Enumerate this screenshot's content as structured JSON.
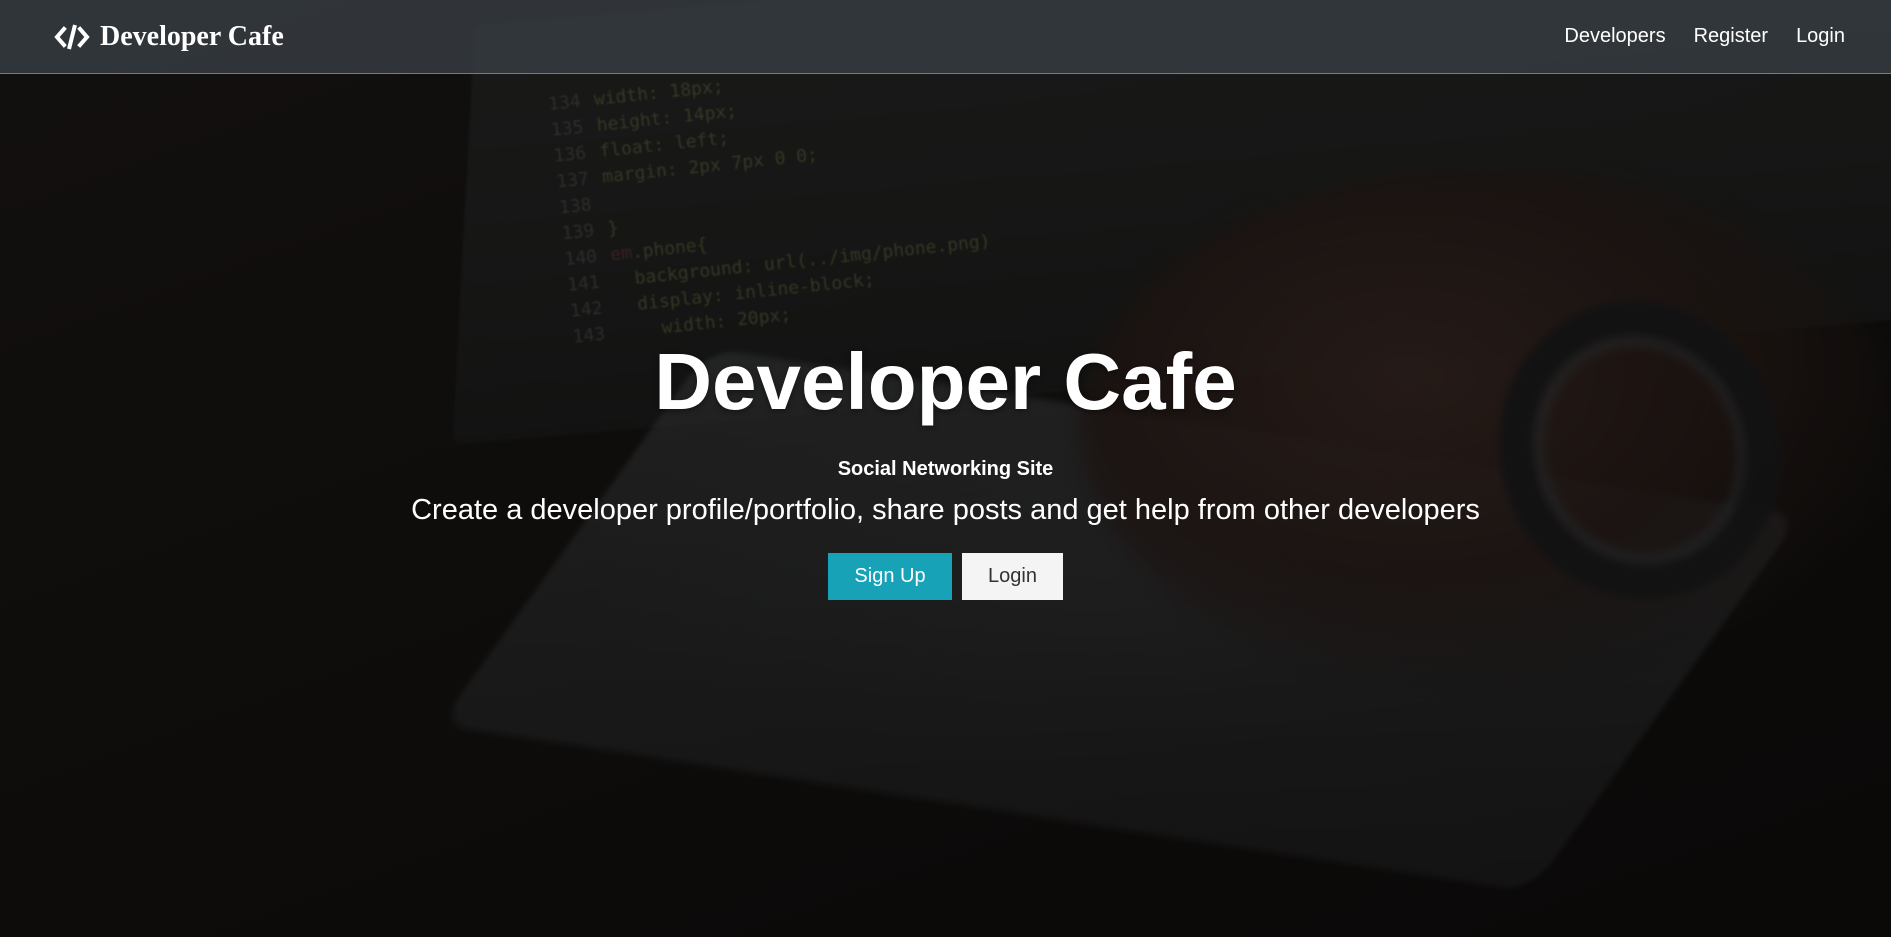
{
  "navbar": {
    "brand": "Developer Cafe",
    "links": [
      "Developers",
      "Register",
      "Login"
    ]
  },
  "landing": {
    "title": "Developer Cafe",
    "subtitle": "Social Networking Site",
    "lead": "Create a developer profile/portfolio, share posts and get help from other developers",
    "buttons": {
      "signup": "Sign Up",
      "login": "Login"
    }
  },
  "colors": {
    "accent": "#17a2b8",
    "navbar_bg": "#343a40",
    "light_button": "#f4f4f4"
  },
  "icons": {
    "brand_icon": "code-icon"
  }
}
